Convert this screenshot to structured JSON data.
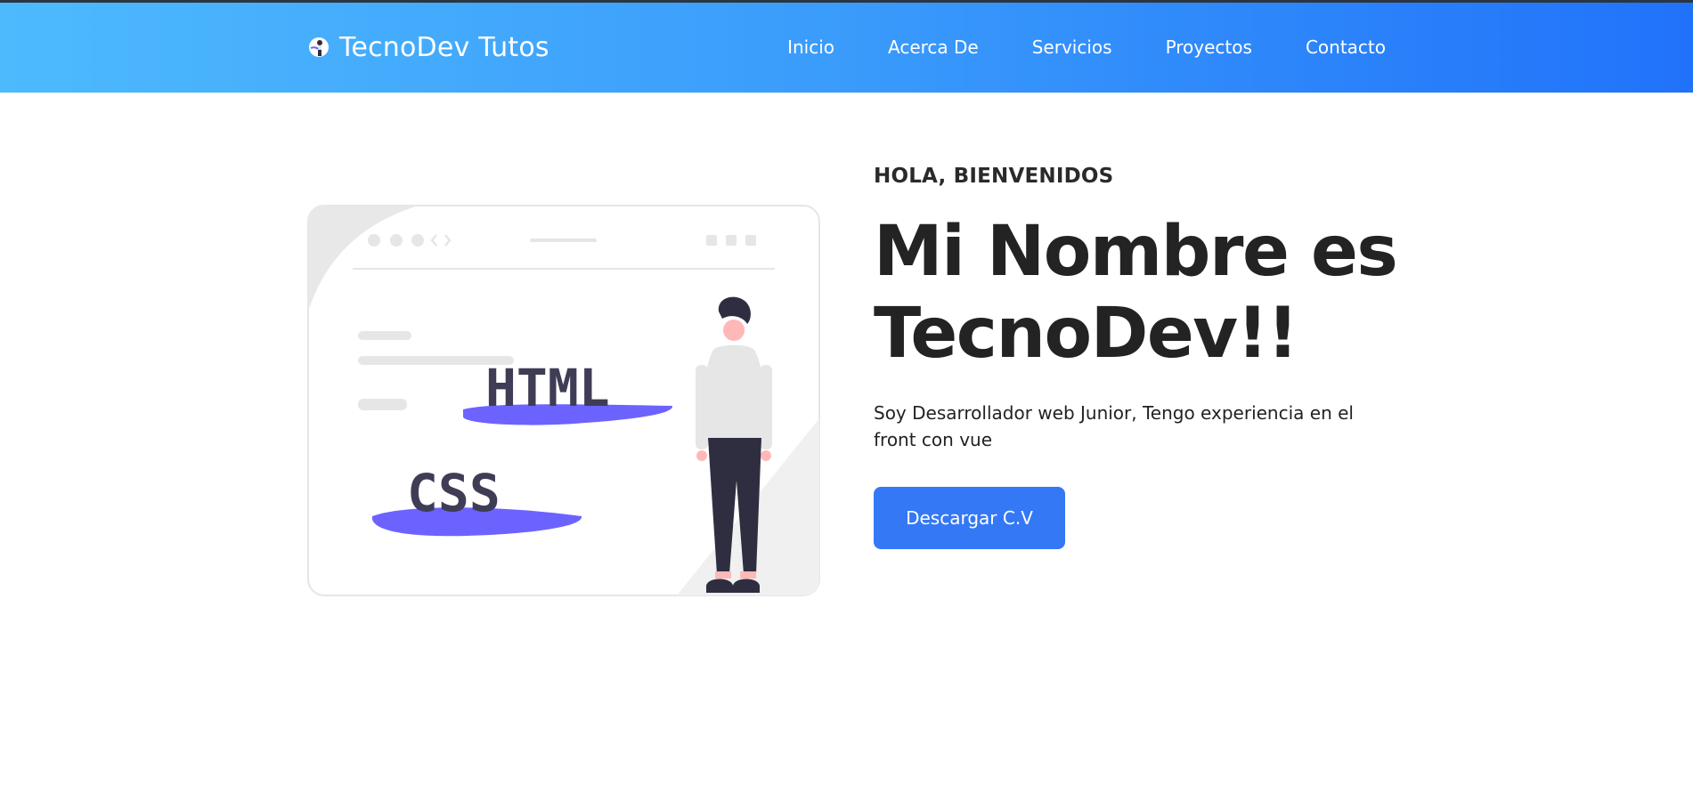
{
  "brand": {
    "name": "TecnoDev Tutos",
    "logo_icon": "developer-logo-icon"
  },
  "nav": {
    "items": [
      {
        "label": "Inicio"
      },
      {
        "label": "Acerca De"
      },
      {
        "label": "Servicios"
      },
      {
        "label": "Proyectos"
      },
      {
        "label": "Contacto"
      }
    ]
  },
  "hero": {
    "greeting": "HOLA, BIENVENIDOS",
    "headline": "Mi Nombre es TecnoDev!!",
    "description": "Soy Desarrollador web Junior, Tengo experiencia en el front con vue",
    "cta_label": "Descargar C.V",
    "illustration": {
      "icon": "web-developer-illustration",
      "html_text": "HTML",
      "css_text": "CSS"
    }
  },
  "colors": {
    "nav_gradient_start": "#4dbafe",
    "nav_gradient_end": "#2172fa",
    "button": "#3478f6",
    "accent_blob": "#6c63ff",
    "text_dark": "#232323"
  }
}
